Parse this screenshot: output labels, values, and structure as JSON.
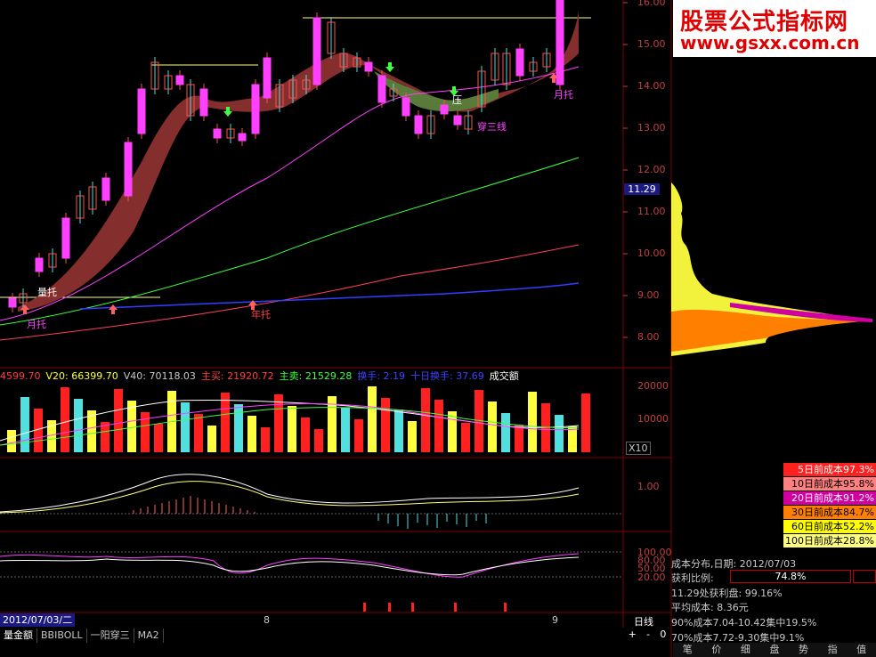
{
  "watermark": {
    "title": "股票公式指标网",
    "url": "www.gsxx.com.cn"
  },
  "price_axis": [
    "16.00",
    "15.00",
    "14.00",
    "13.00",
    "12.00",
    "11.00",
    "10.00",
    "9.00",
    "8.00"
  ],
  "current_price": "11.29",
  "chart_labels": {
    "yue_tuo_1": "月托",
    "liang_tuo": "量托",
    "nian_tuo": "年托",
    "chuan_san_xian": "穿三线",
    "ya": "压",
    "yue_tuo_2": "月托"
  },
  "volume_header": [
    {
      "text": "4599.70",
      "color": "#ff4040"
    },
    {
      "text": "V20: 66399.70",
      "color": "#ffff40"
    },
    {
      "text": "V40: 70118.03",
      "color": "#c8c8c8"
    },
    {
      "text": "主买: 21920.72",
      "color": "#ff4040"
    },
    {
      "text": "主卖: 21529.28",
      "color": "#40ff40"
    },
    {
      "text": "换手: 2.19",
      "color": "#4040ff"
    },
    {
      "text": "十日换手: 37.69",
      "color": "#4040ff"
    },
    {
      "text": "成交额",
      "color": "#ffffff"
    }
  ],
  "volume_axis": [
    "20000",
    "10000"
  ],
  "volume_unit": "X10",
  "osc1_axis": [
    "1.00"
  ],
  "osc2_axis": [
    "100.00",
    "80.00",
    "50.00",
    "20.00"
  ],
  "date_label": "2012/07/03/二",
  "month_labels": [
    "8",
    "9"
  ],
  "period": "日线",
  "cost_rows": [
    {
      "label": "5日前成本97.3%",
      "bg": "#ff2020",
      "fg": "#ffffff"
    },
    {
      "label": "10日前成本95.8%",
      "bg": "#ff8080",
      "fg": "#000000"
    },
    {
      "label": "20日前成本91.2%",
      "bg": "#d000a0",
      "fg": "#ffffff"
    },
    {
      "label": "30日前成本84.7%",
      "bg": "#ff8000",
      "fg": "#000000"
    },
    {
      "label": "60日前成本52.2%",
      "bg": "#ffff00",
      "fg": "#000000"
    },
    {
      "label": "100日前成本28.8%",
      "bg": "#ffff80",
      "fg": "#000000"
    }
  ],
  "cost_info": {
    "title": "成本分布,日期: 2012/07/03",
    "profit_label": "获利比例:",
    "profit_value": "74.8%",
    "profit_at": "11.29处获利盘: 99.16%",
    "avg_cost": "平均成本: 8.36元",
    "c90": "90%成本7.04-10.42集中19.5%",
    "c70": "70%成本7.72-9.30集中9.1%"
  },
  "tabs": [
    "量金额",
    "BBIBOLL",
    "一阳穿三",
    "MA2"
  ],
  "zoom_controls": [
    "+",
    "-",
    "0"
  ],
  "bottom_tabs": [
    "笔",
    "价",
    "细",
    "盘",
    "势",
    "指",
    "值"
  ],
  "colors": {
    "up": "#ff3030",
    "down": "#50e0e0",
    "magenta": "#ff40ff",
    "brown": "#8b3030",
    "green_band": "#608040"
  }
}
